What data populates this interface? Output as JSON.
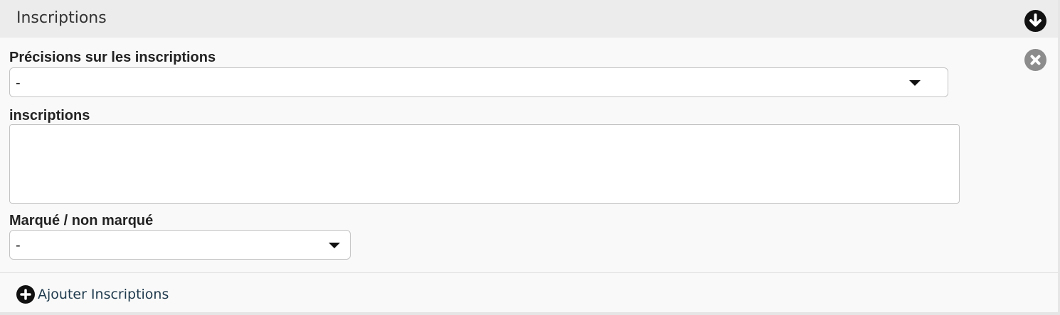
{
  "panel": {
    "title": "Inscriptions",
    "collapse_icon": "arrow-circle-down-icon",
    "remove_icon": "times-circle-icon"
  },
  "fields": {
    "precisions": {
      "label": "Précisions sur les inscriptions",
      "value": "-"
    },
    "inscriptions": {
      "label": "inscriptions",
      "value": ""
    },
    "marque": {
      "label": "Marqué / non marqué",
      "value": "-"
    }
  },
  "footer": {
    "add_label": "Ajouter Inscriptions",
    "add_icon": "plus-circle-icon"
  },
  "colors": {
    "header_bg": "#ececec",
    "body_bg": "#f9f9f9",
    "link": "#1f3a4d",
    "remove_icon": "#8c8c8c"
  }
}
